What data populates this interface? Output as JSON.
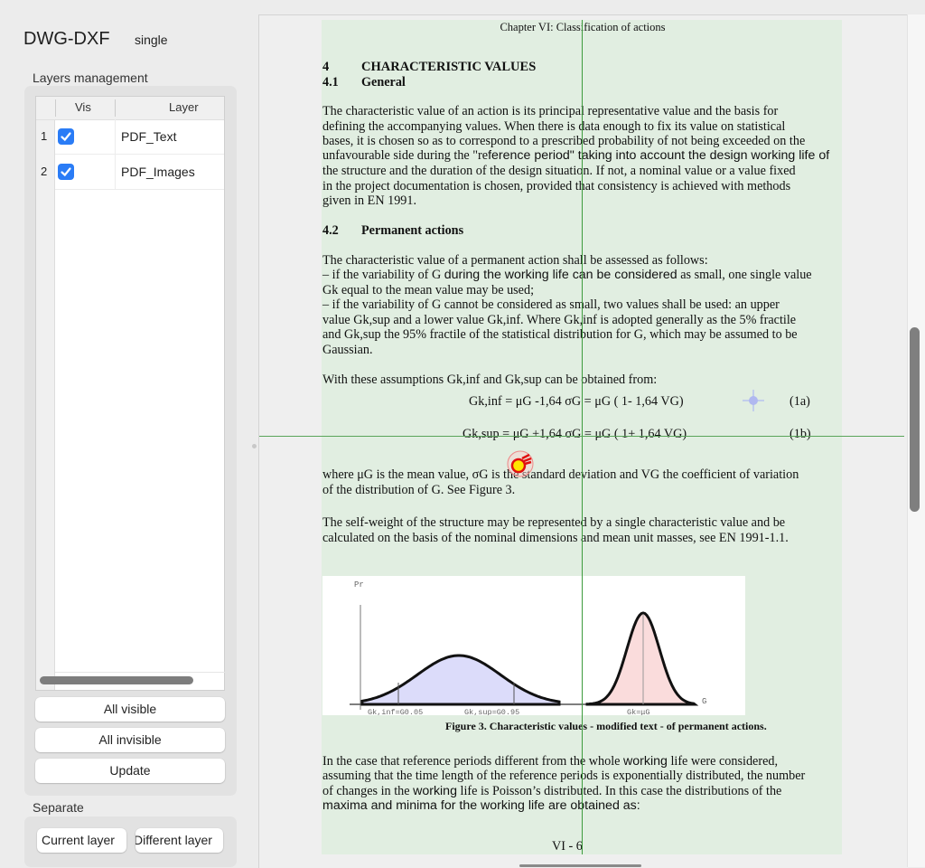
{
  "app": {
    "title": "DWG-DXF",
    "mode": "single"
  },
  "layers": {
    "label": "Layers management",
    "columns": [
      "Vis",
      "Layer"
    ],
    "rows": [
      {
        "num": "1",
        "visible": true,
        "name": "PDF_Text"
      },
      {
        "num": "2",
        "visible": true,
        "name": "PDF_Images"
      }
    ],
    "buttons": {
      "all_visible": "All visible",
      "all_invisible": "All invisible",
      "update": "Update"
    }
  },
  "separate": {
    "label": "Separate",
    "current": "Current layer",
    "different": "Different layer"
  },
  "colors": {
    "checkbox": "#2a7cf6",
    "page_bg": "#e1eee1",
    "crosshair": "#3d9b3d",
    "dist1": "#dcdcfa",
    "dist2": "#fadcdc"
  },
  "document": {
    "header": "Chapter VI: Classification of actions",
    "h1_num": "4",
    "h1": "CHARACTERISTIC VALUES",
    "h2_num": "4.1",
    "h2": "General",
    "h3_num": "4.2",
    "h3": "Permanent actions",
    "lines": [
      [
        "The characteristic value of an action is its principal representative value and the basis for"
      ],
      [
        "defining the accompanying values. When there is data enough to fix its value on statistical"
      ],
      [
        "bases, it is chosen so as to correspond to a prescribed probability of not being exceeded on the"
      ],
      [
        "unfavourable side during the \"re",
        "ference period\" taking into account the design working life of"
      ],
      [
        "the structure and the duration of the design situation. If not, a nominal value or a value fixed"
      ],
      [
        "in the project documentation is chosen, provided that consistency is achieved with methods"
      ],
      [
        "given in EN 1991."
      ],
      [
        "The characteristic value of a permanent action shall be assessed as follows:"
      ],
      [
        "–  if the variability of G ",
        "during the working life can be considered",
        " as small, one single value"
      ],
      [
        "    Gk equal to the mean value may be used;"
      ],
      [
        "–  if the variability of G cannot be considered as small, two values shall be used: an upper"
      ],
      [
        "    value Gk,sup and a lower value Gk,inf. Where Gk,inf is adopted generally as the 5% fractile"
      ],
      [
        "    and Gk,sup the 95% fractile of the statistical distribution for G, which may be assumed to be"
      ],
      [
        "    Gaussian."
      ],
      [
        "With these assumptions Gk,inf and Gk,sup can be obtained from:"
      ],
      [
        "where μG  is the mean value, σG   is the standard deviation and VG the coefficient of variation"
      ],
      [
        "of the distribution of G. See Figure 3."
      ],
      [
        "The self-weight of the structure may be represented by a single characteristic value and be"
      ],
      [
        "calculated on the basis of the nominal dimensions and mean unit masses, see EN 1991-1.1."
      ],
      [
        "In the case that reference periods different from the whole ",
        "working",
        " life were considered,"
      ],
      [
        "assuming that the time length of the reference periods is exponentially distributed, the number"
      ],
      [
        "of changes in the ",
        "working",
        " life is Poisson’s distributed. In this case the distributions of the"
      ],
      [
        "",
        "maxima and minima for the working life are obtained as:"
      ]
    ],
    "eq1": "Gk,inf = μG -1,64 σG  =  μG ( 1- 1,64 VG)",
    "eq1_num": "(1a)",
    "eq2": "Gk,sup = μG +1,64 σG  =  μG ( 1+ 1,64 VG)",
    "eq2_num": "(1b)",
    "figure": {
      "y_label": "Pr",
      "x_label": "G",
      "label1": "Gk,inf=G0.05",
      "label2": "Gk,sup=G0.95",
      "label3": "Gk=μG",
      "caption": "Figure 3. Characteristic values - modified text - of permanent actions."
    },
    "footer": "VI - 6"
  }
}
